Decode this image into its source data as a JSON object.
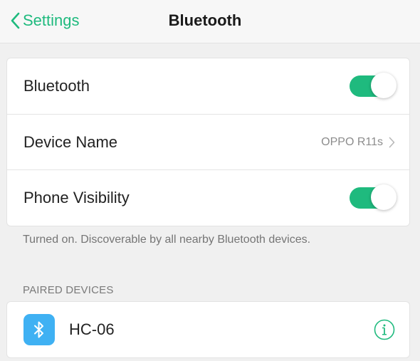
{
  "nav": {
    "back_label": "Settings",
    "title": "Bluetooth"
  },
  "settings": {
    "bluetooth": {
      "label": "Bluetooth",
      "enabled": true
    },
    "device_name": {
      "label": "Device Name",
      "value": "OPPO R11s"
    },
    "phone_visibility": {
      "label": "Phone Visibility",
      "enabled": true
    },
    "footnote": "Turned on. Discoverable by all nearby Bluetooth devices."
  },
  "paired": {
    "header": "PAIRED DEVICES",
    "devices": [
      {
        "name": "HC-06",
        "icon": "bluetooth-icon",
        "action_icon": "info-icon"
      }
    ]
  },
  "colors": {
    "accent": "#1fba7e",
    "device_icon_bg": "#3fb1f3"
  }
}
